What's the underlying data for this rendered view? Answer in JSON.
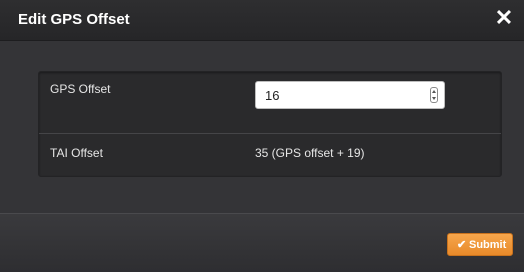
{
  "dialog": {
    "title": "Edit GPS Offset",
    "close_icon": "close-icon"
  },
  "form": {
    "gps_offset_label": "GPS Offset",
    "gps_offset_value": "16",
    "tai_offset_label": "TAI Offset",
    "tai_offset_value": "35 (GPS offset + 19)"
  },
  "footer": {
    "submit_label": "Submit",
    "submit_icon": "check-icon"
  },
  "colors": {
    "accent": "#f19a3a",
    "background": "#333336"
  }
}
